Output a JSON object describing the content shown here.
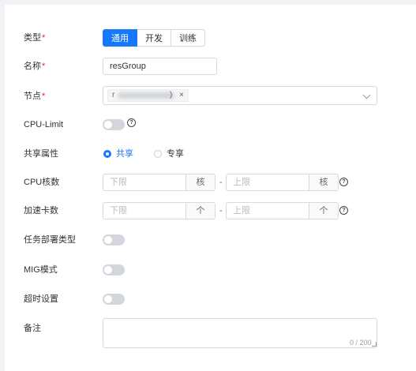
{
  "form": {
    "type": {
      "label": "类型",
      "required_mark": "*",
      "options": [
        "通用",
        "开发",
        "训练"
      ],
      "selected": "通用"
    },
    "name": {
      "label": "名称",
      "required_mark": "*",
      "value": "resGroup"
    },
    "node": {
      "label": "节点",
      "required_mark": "*",
      "tag_visible_prefix": "r",
      "tag_visible_suffix": ")",
      "tag_close": "×"
    },
    "cpu_limit": {
      "label": "CPU-Limit",
      "enabled": false,
      "help": "?"
    },
    "share": {
      "label": "共享属性",
      "options": [
        "共享",
        "专享"
      ],
      "selected": "共享"
    },
    "cpu_cores": {
      "label": "CPU核数",
      "min_placeholder": "下限",
      "max_placeholder": "上限",
      "unit": "核",
      "separator": "-",
      "help": "?"
    },
    "accelerator": {
      "label": "加速卡数",
      "min_placeholder": "下限",
      "max_placeholder": "上限",
      "unit": "个",
      "separator": "-",
      "help": "?"
    },
    "task_deploy": {
      "label": "任务部署类型",
      "enabled": false
    },
    "mig": {
      "label": "MIG模式",
      "enabled": false
    },
    "timeout": {
      "label": "超时设置",
      "enabled": false
    },
    "remark": {
      "label": "备注",
      "counter": "0 / 200"
    }
  },
  "colors": {
    "accent": "#1677ff",
    "required": "#f5222d",
    "switch_off": "#d3d6db"
  }
}
